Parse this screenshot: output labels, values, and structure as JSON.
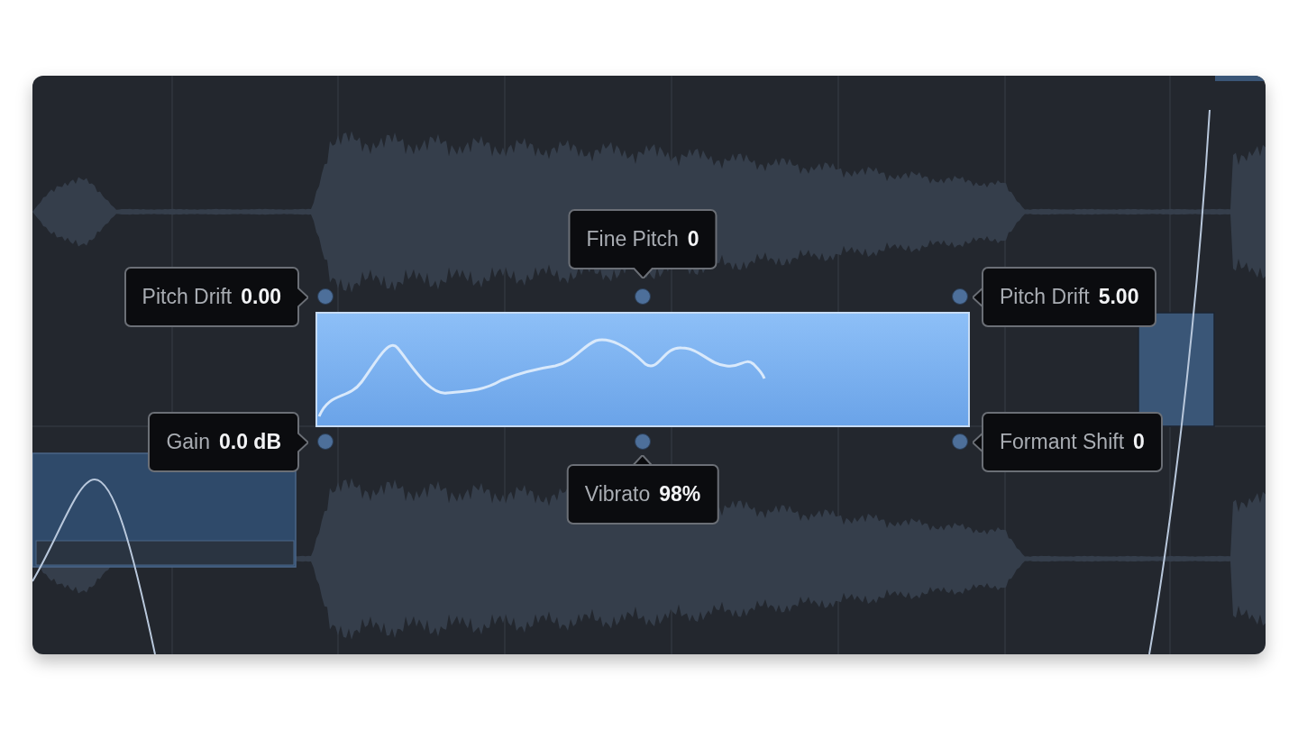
{
  "parameters": [
    {
      "kind": "topleft",
      "label": "Pitch Drift",
      "value": "0.00"
    },
    {
      "kind": "top",
      "label": "Fine Pitch",
      "value": "0"
    },
    {
      "kind": "topright",
      "label": "Pitch Drift",
      "value": "5.00"
    },
    {
      "kind": "bottomleft",
      "label": "Gain",
      "value": "0.0 dB"
    },
    {
      "kind": "bottom",
      "label": "Vibrato",
      "value": "98%"
    },
    {
      "kind": "bottomright",
      "label": "Formant Shift",
      "value": "0"
    }
  ]
}
